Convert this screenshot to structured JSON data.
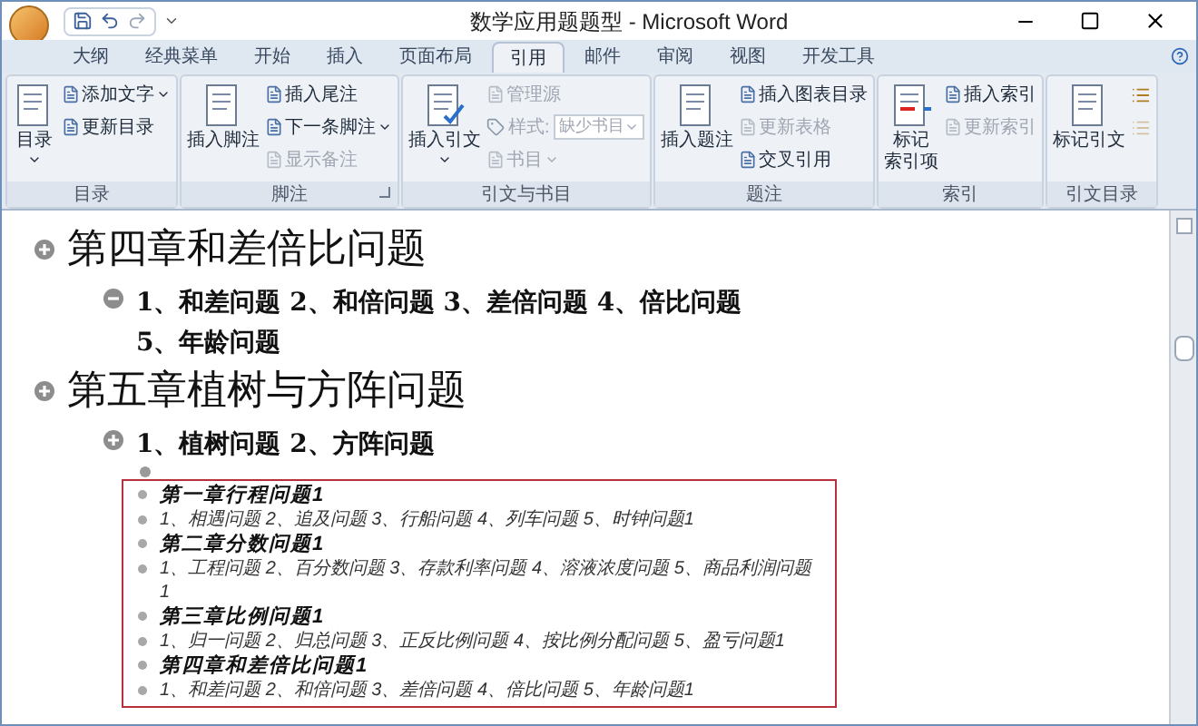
{
  "window": {
    "title": "数学应用题题型 - Microsoft Word"
  },
  "tabs": [
    {
      "label": "大纲",
      "selected": false
    },
    {
      "label": "经典菜单",
      "selected": false
    },
    {
      "label": "开始",
      "selected": false
    },
    {
      "label": "插入",
      "selected": false
    },
    {
      "label": "页面布局",
      "selected": false
    },
    {
      "label": "引用",
      "selected": true
    },
    {
      "label": "邮件",
      "selected": false
    },
    {
      "label": "审阅",
      "selected": false
    },
    {
      "label": "视图",
      "selected": false
    },
    {
      "label": "开发工具",
      "selected": false
    }
  ],
  "ribbon": [
    {
      "name": "目录",
      "launcher": false,
      "items": [
        {
          "kind": "large",
          "label": "目录",
          "dropdown": true,
          "disabled": false
        },
        {
          "kind": "small",
          "label": "添加文字",
          "dropdown": true,
          "disabled": false
        },
        {
          "kind": "small",
          "label": "更新目录",
          "dropdown": false,
          "disabled": false
        }
      ]
    },
    {
      "name": "脚注",
      "launcher": true,
      "items": [
        {
          "kind": "large",
          "label": "插入脚注",
          "dropdown": false,
          "disabled": false
        },
        {
          "kind": "small",
          "label": "插入尾注",
          "dropdown": false,
          "disabled": false
        },
        {
          "kind": "small",
          "label": "下一条脚注",
          "dropdown": true,
          "disabled": false
        },
        {
          "kind": "small",
          "label": "显示备注",
          "dropdown": false,
          "disabled": true
        }
      ]
    },
    {
      "name": "引文与书目",
      "launcher": false,
      "items": [
        {
          "kind": "large",
          "label": "插入引文",
          "dropdown": true,
          "disabled": false
        },
        {
          "kind": "small",
          "label": "管理源",
          "dropdown": false,
          "disabled": true
        },
        {
          "kind": "combo",
          "label": "样式:",
          "value": "缺少书目",
          "dropdown": true,
          "disabled": true
        },
        {
          "kind": "small",
          "label": "书目",
          "dropdown": true,
          "disabled": true
        }
      ]
    },
    {
      "name": "题注",
      "launcher": false,
      "items": [
        {
          "kind": "large",
          "label": "插入题注",
          "dropdown": false,
          "disabled": false
        },
        {
          "kind": "small",
          "label": "插入图表目录",
          "dropdown": false,
          "disabled": false
        },
        {
          "kind": "small",
          "label": "更新表格",
          "dropdown": false,
          "disabled": true
        },
        {
          "kind": "small",
          "label": "交叉引用",
          "dropdown": false,
          "disabled": false
        }
      ]
    },
    {
      "name": "索引",
      "launcher": false,
      "items": [
        {
          "kind": "large",
          "lines": [
            "标记",
            "索引项"
          ],
          "dropdown": false,
          "disabled": false
        },
        {
          "kind": "small",
          "label": "插入索引",
          "dropdown": false,
          "disabled": false
        },
        {
          "kind": "small",
          "label": "更新索引",
          "dropdown": false,
          "disabled": true
        }
      ]
    },
    {
      "name": "引文目录",
      "launcher": false,
      "items": [
        {
          "kind": "large",
          "label": "标记引文",
          "dropdown": false,
          "disabled": false
        },
        {
          "kind": "icon",
          "disabled": false
        },
        {
          "kind": "icon",
          "disabled": true
        }
      ]
    }
  ],
  "outline": [
    {
      "text": "第四章和差倍比问题",
      "has_children": true,
      "children": [
        {
          "text": "1、和差问题 2、和倍问题 3、差倍问题 4、倍比问题 5、年龄问题",
          "has_children": false
        }
      ]
    },
    {
      "text": "第五章植树与方阵问题",
      "has_children": true,
      "children": [
        {
          "text": "1、植树问题 2、方阵问题",
          "has_children": true
        }
      ]
    }
  ],
  "toc": [
    {
      "kind": "chapter",
      "text": "第一章行程问题1"
    },
    {
      "kind": "topics",
      "text": "1、相遇问题 2、追及问题 3、行船问题 4、列车问题 5、时钟问题1"
    },
    {
      "kind": "chapter",
      "text": "第二章分数问题1"
    },
    {
      "kind": "topics",
      "text": "1、工程问题 2、百分数问题 3、存款利率问题 4、溶液浓度问题 5、商品利润问题1"
    },
    {
      "kind": "chapter",
      "text": "第三章比例问题1"
    },
    {
      "kind": "topics",
      "text": "1、归一问题 2、归总问题 3、正反比例问题 4、按比例分配问题 5、盈亏问题1"
    },
    {
      "kind": "chapter",
      "text": "第四章和差倍比问题1"
    },
    {
      "kind": "topics",
      "text": "1、和差问题 2、和倍问题 3、差倍问题 4、倍比问题 5、年龄问题1"
    }
  ]
}
